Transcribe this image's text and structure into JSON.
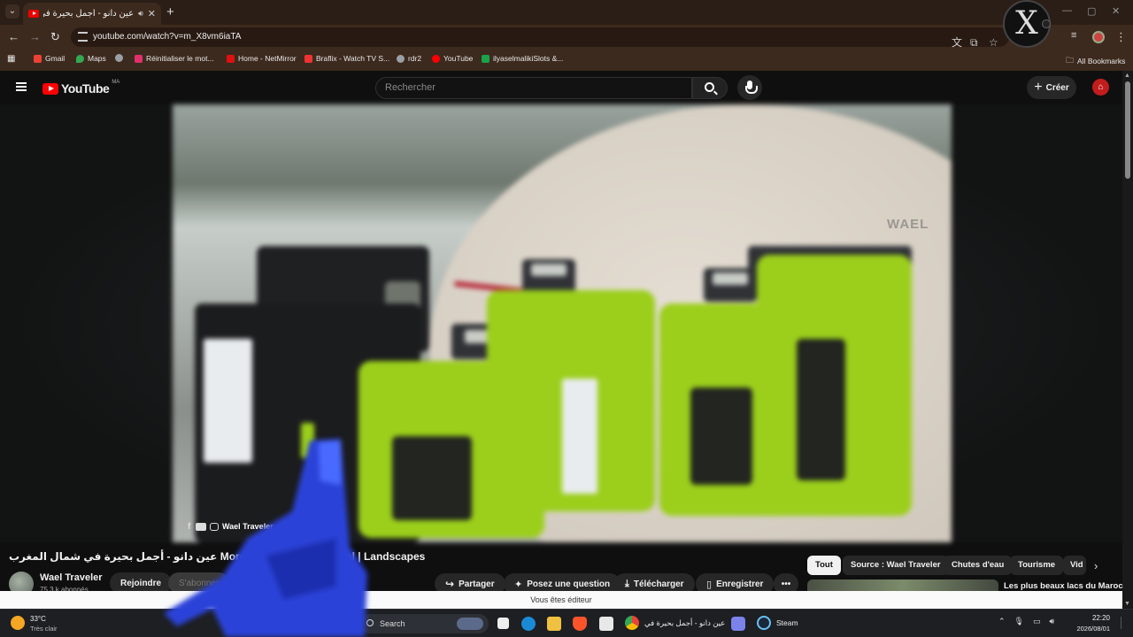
{
  "browser": {
    "tab_title": "عين دانو - أجمل بحيرة في ش...",
    "url": "youtube.com/watch?v=m_X8vm6iaTA",
    "bookmarks": [
      {
        "label": "Gmail",
        "color": "#ea4335"
      },
      {
        "label": "Maps",
        "color": "#34a853"
      },
      {
        "label": "",
        "color": "#9aa0a6"
      },
      {
        "label": "Réinitialiser le mot...",
        "color": "#e1306c"
      },
      {
        "label": "Home - NetMirror",
        "color": "#d11"
      },
      {
        "label": "Braflix - Watch TV S...",
        "color": "#e33"
      },
      {
        "label": "rdr2",
        "color": "#9aa0a6"
      },
      {
        "label": "YouTube",
        "color": "#f00"
      },
      {
        "label": "ilyaselmalikiSlots &...",
        "color": "#1aa34a"
      }
    ],
    "all_bookmarks": "All Bookmarks"
  },
  "youtube": {
    "logo_text": "YouTube",
    "country_code": "MA",
    "search_placeholder": "Rechercher",
    "create_label": "Créer",
    "video": {
      "title": "عين دانو - أجمل بحيرة في شمال المغرب Morocco's Most Breathe      al | Landscapes",
      "watermark_channel": "Wael Traveler"
    },
    "channel": {
      "name": "Wael Traveler",
      "subscribers": "75,3 k abonnés",
      "join_label": "Rejoindre",
      "subscribe_label": "S'abonner"
    },
    "actions": {
      "share": "Partager",
      "ask": "Posez une question",
      "download": "Télécharger",
      "save": "Enregistrer",
      "more": "•••"
    },
    "chips": [
      "Tout",
      "Source : Wael Traveler",
      "Chutes d'eau",
      "Tourisme",
      "Vid"
    ],
    "recommendation_title": "Les plus beaux lacs du Maroc",
    "editor_notice": "Vous êtes éditeur"
  },
  "taskbar": {
    "temperature": "33°C",
    "weather": "Très clair",
    "search_label": "Search",
    "chrome_app": "عين دانو - أجمل بحيرة في",
    "steam_app": "Steam",
    "time": "22:20",
    "date": "2026/08/01"
  }
}
